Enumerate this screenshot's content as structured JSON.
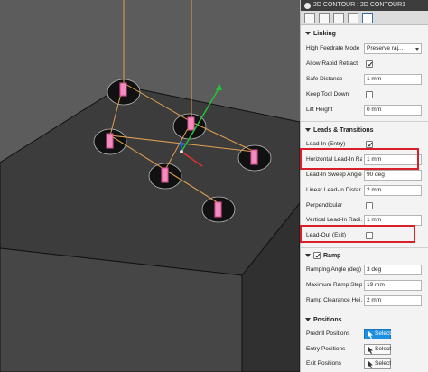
{
  "panel": {
    "title": "2D CONTOUR : 2D CONTOUR1",
    "tabs": [
      "tool-tab-icon",
      "geometry-tab-icon",
      "heights-tab-icon",
      "passes-tab-icon",
      "linking-tab-icon"
    ],
    "sections": {
      "linking": {
        "header": "Linking",
        "high_feedrate_mode": {
          "label": "High Feedrate Mode",
          "value": "Preserve raj..."
        },
        "allow_rapid_retract": {
          "label": "Allow Rapid Retract",
          "checked": true
        },
        "safe_distance": {
          "label": "Safe Distance",
          "value": "1 mm"
        },
        "keep_tool_down": {
          "label": "Keep Tool Down",
          "checked": false
        },
        "lift_height": {
          "label": "Lift Height",
          "value": "0 mm"
        }
      },
      "leads": {
        "header": "Leads & Transitions",
        "lead_in": {
          "label": "Lead-In (Entry)",
          "checked": true
        },
        "horizontal_lead_in_radius": {
          "label": "Horizontal Lead-In Ra...",
          "value": "1 mm"
        },
        "lead_in_sweep_angle": {
          "label": "Lead-In Sweep Angle",
          "value": "90 deg"
        },
        "linear_lead_in_distance": {
          "label": "Linear Lead-In Distar...",
          "value": "2 mm"
        },
        "perpendicular": {
          "label": "Perpendicular",
          "checked": false
        },
        "vertical_lead_in_radius": {
          "label": "Vertical Lead-In Radi...",
          "value": "1 mm"
        },
        "lead_out": {
          "label": "Lead-Out (Exit)",
          "checked": false
        }
      },
      "ramp": {
        "header": "Ramp",
        "enabled": true,
        "ramping_angle": {
          "label": "Ramping Angle (deg)",
          "value": "3 deg"
        },
        "maximum_ramp_step": {
          "label": "Maximum Ramp Step...",
          "value": "19 mm"
        },
        "ramp_clearance_height": {
          "label": "Ramp Clearance Hei...",
          "value": "2 mm"
        }
      },
      "positions": {
        "header": "Positions",
        "predrill": {
          "label": "Predrill Positions",
          "button": "Select"
        },
        "entry": {
          "label": "Entry Positions",
          "button": "Select"
        },
        "exit": {
          "label": "Exit Positions",
          "button": "Select"
        }
      }
    },
    "highlight_color": "#d8202a",
    "active_button_color": "#1f8fe0"
  }
}
